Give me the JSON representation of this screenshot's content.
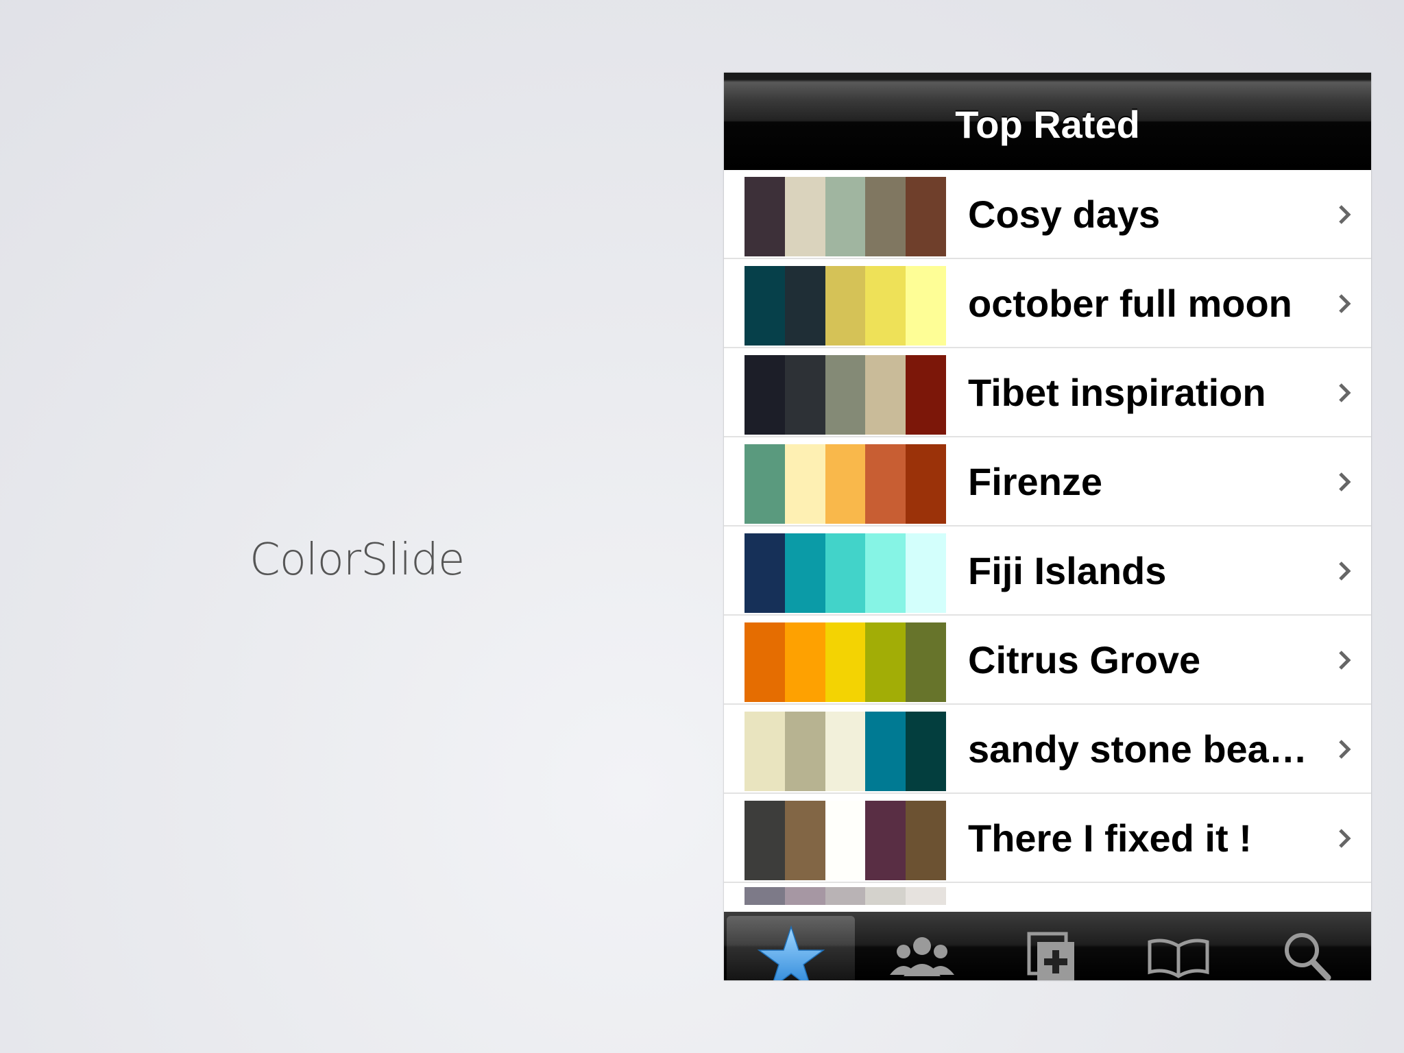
{
  "slide": {
    "title": "ColorSlide"
  },
  "navbar": {
    "title": "Top Rated"
  },
  "palettes": [
    {
      "name": "Cosy days",
      "colors": [
        "#3d3039",
        "#dad3bd",
        "#a0b5a0",
        "#807761",
        "#6f3f2b"
      ]
    },
    {
      "name": "october full moon",
      "colors": [
        "#06404a",
        "#1f2e36",
        "#d5c257",
        "#eee158",
        "#fefe96"
      ]
    },
    {
      "name": "Tibet inspiration",
      "colors": [
        "#1c1e28",
        "#2d3136",
        "#848a76",
        "#c9bb99",
        "#7c1709"
      ]
    },
    {
      "name": "Firenze",
      "colors": [
        "#5a9a7e",
        "#fef0b3",
        "#f9b84b",
        "#c85e33",
        "#9b3209"
      ]
    },
    {
      "name": "Fiji Islands",
      "colors": [
        "#163058",
        "#0b9ba7",
        "#42d3c9",
        "#86f4e5",
        "#d3fffc"
      ]
    },
    {
      "name": "Citrus Grove",
      "colors": [
        "#e56d01",
        "#fea101",
        "#f3d303",
        "#a2ad06",
        "#67742b"
      ]
    },
    {
      "name": "sandy stone bea…",
      "colors": [
        "#e9e4bf",
        "#b7b391",
        "#f2f0da",
        "#007a93",
        "#033e3e"
      ]
    },
    {
      "name": "There I fixed it !",
      "colors": [
        "#3d3d3b",
        "#826645",
        "#fffffb",
        "#592e44",
        "#6c5232"
      ]
    }
  ],
  "partial_palette": {
    "colors": [
      "#7d7a88",
      "#a697a3",
      "#b9b3b5",
      "#d4d2cc",
      "#e6e2de"
    ]
  },
  "tabbar": {
    "tabs": [
      {
        "icon": "star-icon",
        "active": true
      },
      {
        "icon": "people-icon",
        "active": false
      },
      {
        "icon": "add-palette-icon",
        "active": false
      },
      {
        "icon": "book-icon",
        "active": false
      },
      {
        "icon": "search-icon",
        "active": false
      }
    ]
  },
  "colors": {
    "accent_blue": "#3a9be8",
    "tab_icon_gray": "#9a9a9a"
  }
}
